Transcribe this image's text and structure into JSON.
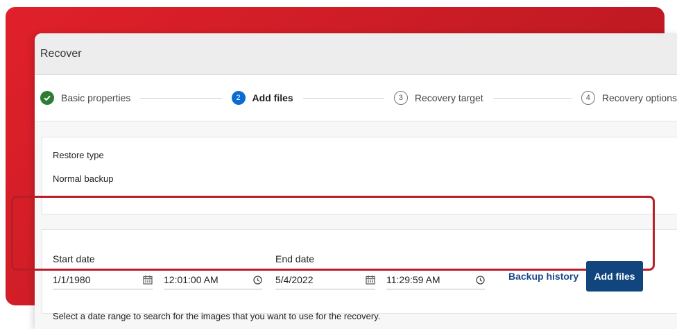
{
  "window": {
    "title": "Recover"
  },
  "stepper": {
    "steps": [
      {
        "number": "✓",
        "label": "Basic properties",
        "state": "done"
      },
      {
        "number": "2",
        "label": "Add files",
        "state": "active"
      },
      {
        "number": "3",
        "label": "Recovery target",
        "state": "pending"
      },
      {
        "number": "4",
        "label": "Recovery options",
        "state": "pending"
      }
    ]
  },
  "restore": {
    "label": "Restore type",
    "value": "Normal backup"
  },
  "range": {
    "start_label": "Start date",
    "start_date": "1/1/1980",
    "start_time": "12:01:00 AM",
    "end_label": "End date",
    "end_date": "5/4/2022",
    "end_time": "11:29:59 AM",
    "backup_history": "Backup history",
    "add_files": "Add files",
    "helper": "Select a date range to search for the images that you want to use for the recovery."
  },
  "colors": {
    "accent": "#0a6cd1",
    "done": "#2e7d32",
    "primary_button": "#10457d",
    "highlight": "#b81e28",
    "background_red": "#d61f28"
  },
  "icons": {
    "calendar": "calendar-icon",
    "clock": "clock-icon",
    "check": "check-icon"
  }
}
